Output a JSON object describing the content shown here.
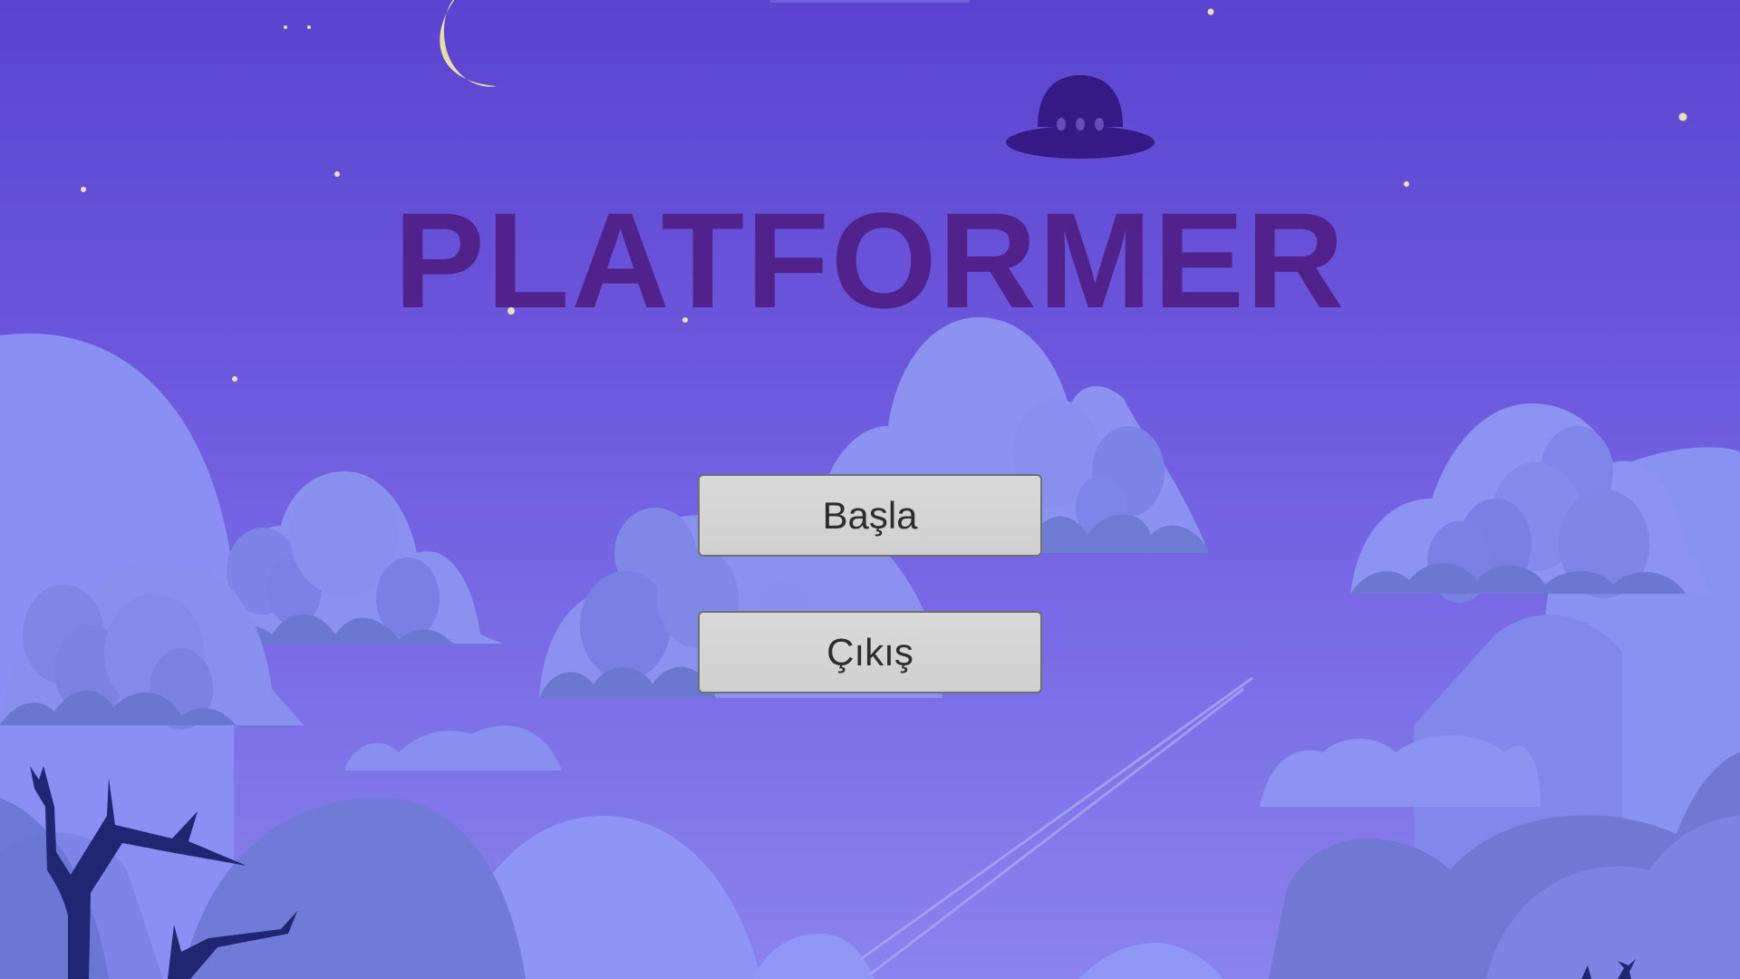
{
  "game": {
    "title": "PLATFORMER"
  },
  "menu": {
    "start_label": "Başla",
    "exit_label": "Çıkış"
  },
  "colors": {
    "sky_top": "#5a44cf",
    "sky_bottom": "#8a82ee",
    "title": "#52228c",
    "button_fill": "#d3d3d3",
    "button_border": "#6f6f6f",
    "button_text": "#2d2d2d",
    "moon": "#e8dfa8",
    "ufo": "#351a86",
    "trees": "#1f2672"
  },
  "icons": [
    "moon-icon",
    "ufo-icon",
    "tree-icon"
  ]
}
